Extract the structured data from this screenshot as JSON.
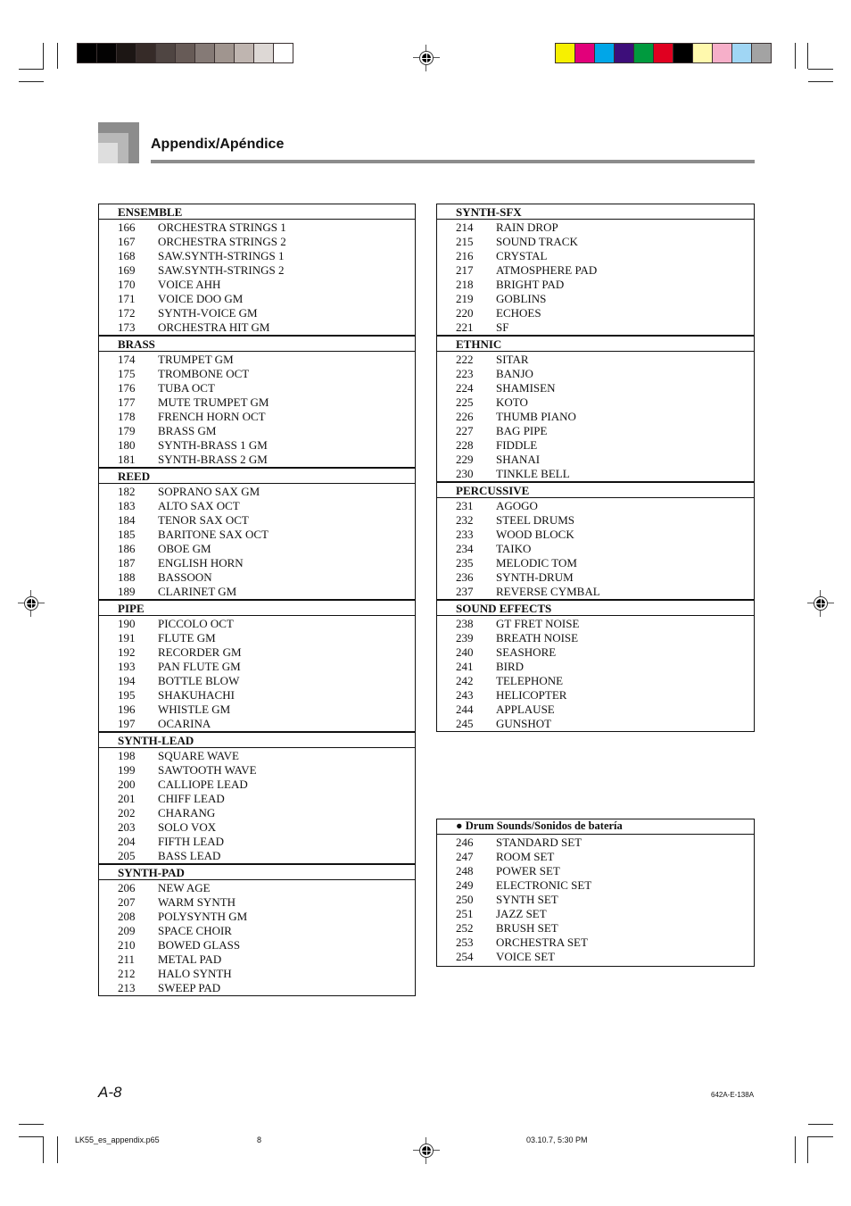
{
  "print_marks": {
    "gray_swatches": [
      "#000000",
      "#040303",
      "#1c1614",
      "#362b28",
      "#4f4542",
      "#675b57",
      "#857a76",
      "#a0958f",
      "#bfb5b0",
      "#ddd8d5",
      "#ffffff"
    ],
    "color_swatches": [
      "#f7f000",
      "#e2007a",
      "#00a6e8",
      "#3d0e7a",
      "#009a3e",
      "#e00020",
      "#000000",
      "#fff9ad",
      "#f6afc9",
      "#a0d6f4",
      "#a3a3a3"
    ]
  },
  "header": {
    "title": "Appendix/Apéndice"
  },
  "left_table": {
    "sections": [
      {
        "title": "ENSEMBLE",
        "items": [
          {
            "num": "166",
            "name": "ORCHESTRA STRINGS 1"
          },
          {
            "num": "167",
            "name": "ORCHESTRA STRINGS 2"
          },
          {
            "num": "168",
            "name": "SAW.SYNTH-STRINGS 1"
          },
          {
            "num": "169",
            "name": "SAW.SYNTH-STRINGS 2"
          },
          {
            "num": "170",
            "name": "VOICE AHH"
          },
          {
            "num": "171",
            "name": "VOICE DOO GM"
          },
          {
            "num": "172",
            "name": "SYNTH-VOICE GM"
          },
          {
            "num": "173",
            "name": "ORCHESTRA HIT GM"
          }
        ]
      },
      {
        "title": "BRASS",
        "items": [
          {
            "num": "174",
            "name": "TRUMPET GM"
          },
          {
            "num": "175",
            "name": "TROMBONE OCT"
          },
          {
            "num": "176",
            "name": "TUBA OCT"
          },
          {
            "num": "177",
            "name": "MUTE TRUMPET GM"
          },
          {
            "num": "178",
            "name": "FRENCH HORN OCT"
          },
          {
            "num": "179",
            "name": "BRASS GM"
          },
          {
            "num": "180",
            "name": "SYNTH-BRASS 1 GM"
          },
          {
            "num": "181",
            "name": "SYNTH-BRASS 2 GM"
          }
        ]
      },
      {
        "title": "REED",
        "items": [
          {
            "num": "182",
            "name": "SOPRANO SAX GM"
          },
          {
            "num": "183",
            "name": "ALTO SAX OCT"
          },
          {
            "num": "184",
            "name": "TENOR SAX OCT"
          },
          {
            "num": "185",
            "name": "BARITONE SAX OCT"
          },
          {
            "num": "186",
            "name": "OBOE GM"
          },
          {
            "num": "187",
            "name": "ENGLISH HORN"
          },
          {
            "num": "188",
            "name": "BASSOON"
          },
          {
            "num": "189",
            "name": "CLARINET GM"
          }
        ]
      },
      {
        "title": "PIPE",
        "items": [
          {
            "num": "190",
            "name": "PICCOLO OCT"
          },
          {
            "num": "191",
            "name": "FLUTE GM"
          },
          {
            "num": "192",
            "name": "RECORDER GM"
          },
          {
            "num": "193",
            "name": "PAN FLUTE GM"
          },
          {
            "num": "194",
            "name": "BOTTLE BLOW"
          },
          {
            "num": "195",
            "name": "SHAKUHACHI"
          },
          {
            "num": "196",
            "name": "WHISTLE GM"
          },
          {
            "num": "197",
            "name": "OCARINA"
          }
        ]
      },
      {
        "title": "SYNTH-LEAD",
        "items": [
          {
            "num": "198",
            "name": "SQUARE WAVE"
          },
          {
            "num": "199",
            "name": "SAWTOOTH WAVE"
          },
          {
            "num": "200",
            "name": "CALLIOPE LEAD"
          },
          {
            "num": "201",
            "name": "CHIFF LEAD"
          },
          {
            "num": "202",
            "name": "CHARANG"
          },
          {
            "num": "203",
            "name": "SOLO VOX"
          },
          {
            "num": "204",
            "name": "FIFTH LEAD"
          },
          {
            "num": "205",
            "name": "BASS LEAD"
          }
        ]
      },
      {
        "title": "SYNTH-PAD",
        "items": [
          {
            "num": "206",
            "name": "NEW AGE"
          },
          {
            "num": "207",
            "name": "WARM SYNTH"
          },
          {
            "num": "208",
            "name": "POLYSYNTH GM"
          },
          {
            "num": "209",
            "name": "SPACE CHOIR"
          },
          {
            "num": "210",
            "name": "BOWED GLASS"
          },
          {
            "num": "211",
            "name": "METAL PAD"
          },
          {
            "num": "212",
            "name": "HALO SYNTH"
          },
          {
            "num": "213",
            "name": "SWEEP PAD"
          }
        ]
      }
    ]
  },
  "right_table": {
    "sections": [
      {
        "title": "SYNTH-SFX",
        "items": [
          {
            "num": "214",
            "name": "RAIN DROP"
          },
          {
            "num": "215",
            "name": "SOUND TRACK"
          },
          {
            "num": "216",
            "name": "CRYSTAL"
          },
          {
            "num": "217",
            "name": "ATMOSPHERE PAD"
          },
          {
            "num": "218",
            "name": "BRIGHT PAD"
          },
          {
            "num": "219",
            "name": "GOBLINS"
          },
          {
            "num": "220",
            "name": "ECHOES"
          },
          {
            "num": "221",
            "name": "SF"
          }
        ]
      },
      {
        "title": "ETHNIC",
        "items": [
          {
            "num": "222",
            "name": "SITAR"
          },
          {
            "num": "223",
            "name": "BANJO"
          },
          {
            "num": "224",
            "name": "SHAMISEN"
          },
          {
            "num": "225",
            "name": "KOTO"
          },
          {
            "num": "226",
            "name": "THUMB PIANO"
          },
          {
            "num": "227",
            "name": "BAG PIPE"
          },
          {
            "num": "228",
            "name": "FIDDLE"
          },
          {
            "num": "229",
            "name": "SHANAI"
          },
          {
            "num": "230",
            "name": "TINKLE BELL"
          }
        ]
      },
      {
        "title": "PERCUSSIVE",
        "items": [
          {
            "num": "231",
            "name": "AGOGO"
          },
          {
            "num": "232",
            "name": "STEEL DRUMS"
          },
          {
            "num": "233",
            "name": "WOOD BLOCK"
          },
          {
            "num": "234",
            "name": "TAIKO"
          },
          {
            "num": "235",
            "name": "MELODIC TOM"
          },
          {
            "num": "236",
            "name": "SYNTH-DRUM"
          },
          {
            "num": "237",
            "name": "REVERSE CYMBAL"
          }
        ]
      },
      {
        "title": "SOUND EFFECTS",
        "items": [
          {
            "num": "238",
            "name": "GT FRET NOISE"
          },
          {
            "num": "239",
            "name": "BREATH NOISE"
          },
          {
            "num": "240",
            "name": "SEASHORE"
          },
          {
            "num": "241",
            "name": "BIRD"
          },
          {
            "num": "242",
            "name": "TELEPHONE"
          },
          {
            "num": "243",
            "name": "HELICOPTER"
          },
          {
            "num": "244",
            "name": "APPLAUSE"
          },
          {
            "num": "245",
            "name": "GUNSHOT"
          }
        ]
      }
    ]
  },
  "drum_table": {
    "bullet": "●",
    "title": "Drum Sounds/Sonidos de batería",
    "items": [
      {
        "num": "246",
        "name": "STANDARD SET"
      },
      {
        "num": "247",
        "name": "ROOM SET"
      },
      {
        "num": "248",
        "name": "POWER SET"
      },
      {
        "num": "249",
        "name": "ELECTRONIC SET"
      },
      {
        "num": "250",
        "name": "SYNTH SET"
      },
      {
        "num": "251",
        "name": "JAZZ SET"
      },
      {
        "num": "252",
        "name": "BRUSH SET"
      },
      {
        "num": "253",
        "name": "ORCHESTRA SET"
      },
      {
        "num": "254",
        "name": "VOICE SET"
      }
    ]
  },
  "footer": {
    "page_number": "A-8",
    "doc_code": "642A-E-138A",
    "file_name": "LK55_es_appendix.p65",
    "file_page": "8",
    "timestamp": "03.10.7, 5:30 PM"
  }
}
